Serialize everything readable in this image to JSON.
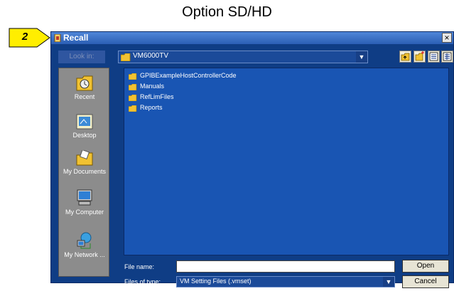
{
  "caption": "Option SD/HD",
  "callout": {
    "number": "2"
  },
  "dialog": {
    "title": "Recall",
    "close_glyph": "×",
    "look_in_label": "Look in:",
    "look_in_value": "VM6000TV",
    "toolbar_icons": [
      "up-folder-icon",
      "new-folder-icon",
      "list-view-icon",
      "details-view-icon"
    ],
    "places": [
      {
        "label": "Recent",
        "icon": "recent-icon"
      },
      {
        "label": "Desktop",
        "icon": "desktop-icon"
      },
      {
        "label": "My Documents",
        "icon": "my-documents-icon"
      },
      {
        "label": "My Computer",
        "icon": "my-computer-icon"
      },
      {
        "label": "My Network ...",
        "icon": "my-network-icon"
      }
    ],
    "files": [
      {
        "name": "GPIBExampleHostControllerCode"
      },
      {
        "name": "Manuals"
      },
      {
        "name": "RefLimFiles"
      },
      {
        "name": "Reports"
      }
    ],
    "file_name_label": "File name:",
    "file_name_value": "",
    "files_of_type_label": "Files of type:",
    "files_of_type_value": "VM Setting Files (.vmset)",
    "open_button": "Open",
    "cancel_button": "Cancel"
  },
  "colors": {
    "dialog_bg": "#0f3d85",
    "titlebar": "#2c5fb5",
    "list_bg": "#1955b3",
    "places_bg": "#8c8c8c",
    "callout_fill": "#ffee00"
  }
}
